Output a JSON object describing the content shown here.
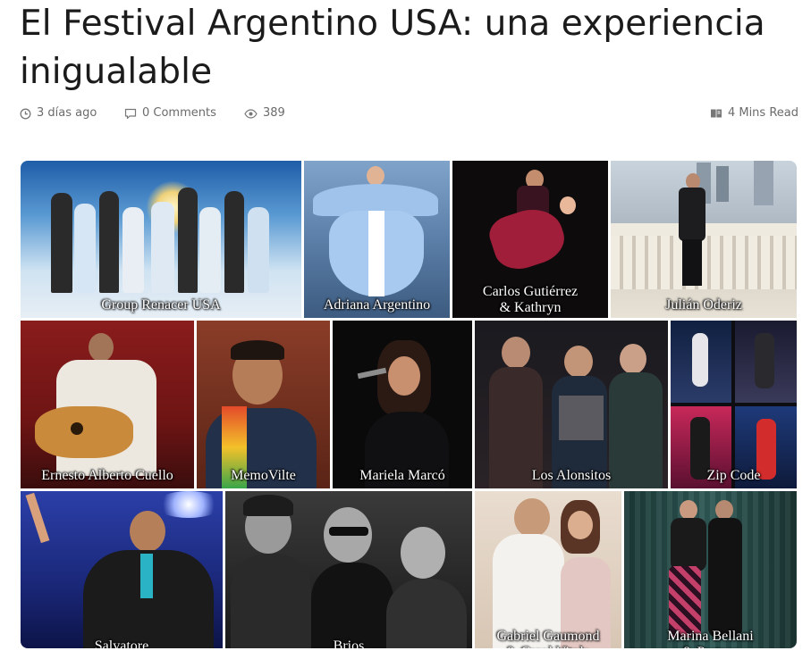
{
  "article": {
    "title": "El Festival Argentino USA: una experiencia inigualable",
    "meta": {
      "date": "3 días ago",
      "comments": "0 Comments",
      "views": "389",
      "read_time": "4 Mins Read"
    }
  },
  "icons": {
    "date": "clock-icon",
    "comments": "comment-icon",
    "views": "eye-icon",
    "read_time": "book-icon"
  },
  "collage": {
    "row1": [
      {
        "caption": "Group Renacer USA"
      },
      {
        "caption": "Adriana Argentino"
      },
      {
        "caption": "Carlos Gutiérrez\n& Kathryn"
      },
      {
        "caption": "Julián Oderiz"
      }
    ],
    "row2": [
      {
        "caption": "Ernesto Alberto Cuello"
      },
      {
        "caption": "MemoVilte"
      },
      {
        "caption": "Mariela Marcó"
      },
      {
        "caption": "Los Alonsitos"
      },
      {
        "caption": "Zip Code"
      }
    ],
    "row3": [
      {
        "caption": "Salvatore"
      },
      {
        "caption": "Brios"
      },
      {
        "caption": "Gabriel Gaumond\n& Carol Vitale"
      },
      {
        "caption": "Marina Bellani\n& Partner"
      }
    ]
  },
  "colors": {
    "title": "#1b1b1b",
    "meta": "#6b6b6b"
  }
}
